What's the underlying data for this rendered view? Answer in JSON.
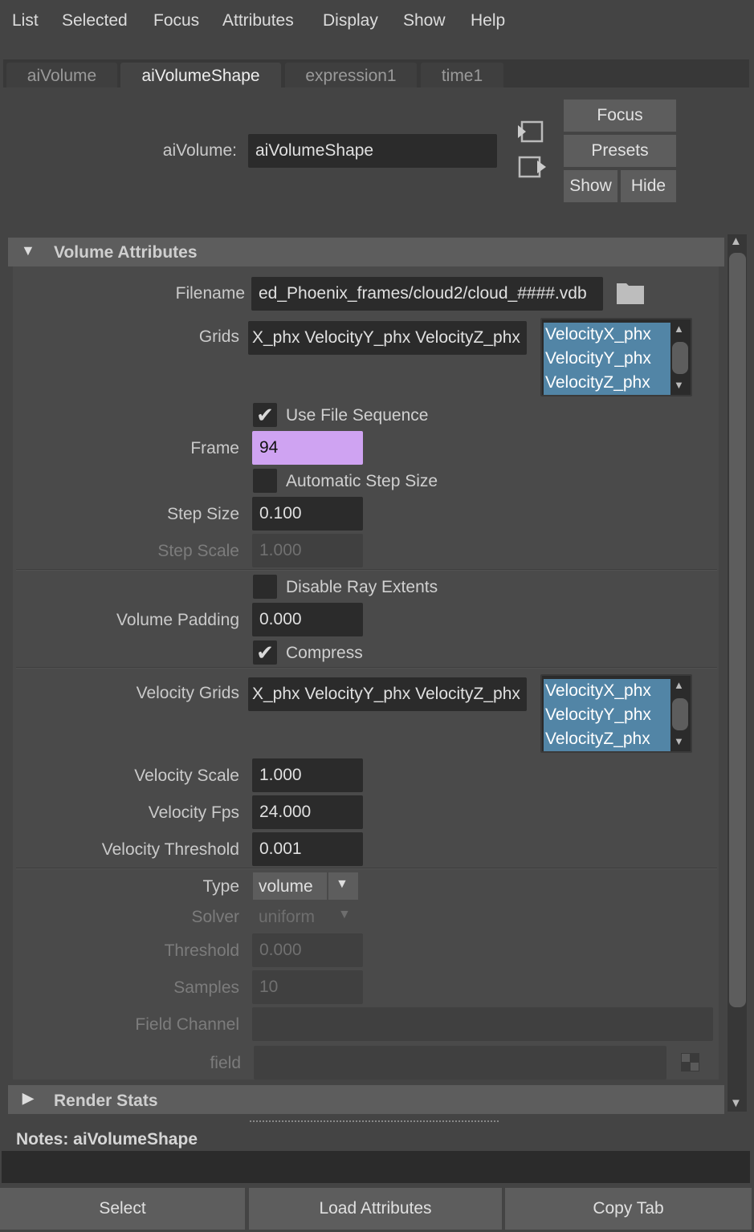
{
  "menu": [
    "List",
    "Selected",
    "Focus",
    "Attributes",
    "Display",
    "Show",
    "Help"
  ],
  "tabs": [
    "aiVolume",
    "aiVolumeShape",
    "expression1",
    "time1"
  ],
  "header": {
    "node_label": "aiVolume:",
    "node_value": "aiVolumeShape",
    "focus": "Focus",
    "presets": "Presets",
    "show": "Show",
    "hide": "Hide"
  },
  "section": {
    "title": "Volume Attributes",
    "collapsed_title": "Render Stats"
  },
  "attrs": {
    "filename_label": "Filename",
    "filename": "ed_Phoenix_frames/cloud2/cloud_####.vdb",
    "grids_label": "Grids",
    "grids": "X_phx VelocityY_phx VelocityZ_phx",
    "grid_list": [
      "VelocityX_phx",
      "VelocityY_phx",
      "VelocityZ_phx"
    ],
    "use_file_sequence": "Use File Sequence",
    "use_file_sequence_checked": true,
    "frame_label": "Frame",
    "frame": "94",
    "frame_color": "#cfa3f2",
    "auto_step": "Automatic Step Size",
    "auto_step_checked": false,
    "step_size_label": "Step Size",
    "step_size": "0.100",
    "step_scale_label": "Step Scale",
    "step_scale": "1.000",
    "disable_ray": "Disable Ray Extents",
    "disable_ray_checked": false,
    "volume_padding_label": "Volume Padding",
    "volume_padding": "0.000",
    "compress": "Compress",
    "compress_checked": true,
    "velocity_grids_label": "Velocity Grids",
    "velocity_grids": "X_phx VelocityY_phx VelocityZ_phx",
    "velocity_grid_list": [
      "VelocityX_phx",
      "VelocityY_phx",
      "VelocityZ_phx"
    ],
    "velocity_scale_label": "Velocity Scale",
    "velocity_scale": "1.000",
    "velocity_fps_label": "Velocity Fps",
    "velocity_fps": "24.000",
    "velocity_threshold_label": "Velocity Threshold",
    "velocity_threshold": "0.001",
    "type_label": "Type",
    "type": "volume",
    "solver_label": "Solver",
    "solver": "uniform",
    "threshold_label": "Threshold",
    "threshold": "0.000",
    "samples_label": "Samples",
    "samples": "10",
    "field_channel_label": "Field Channel",
    "field_channel": "",
    "field_label": "field",
    "field": ""
  },
  "notes": {
    "label": "Notes:  aiVolumeShape",
    "text": ""
  },
  "bottom": [
    "Select",
    "Load Attributes",
    "Copy Tab"
  ],
  "colors": {
    "selection": "#5285a6",
    "section": "#5d5d5d",
    "field": "#2b2b2b"
  }
}
